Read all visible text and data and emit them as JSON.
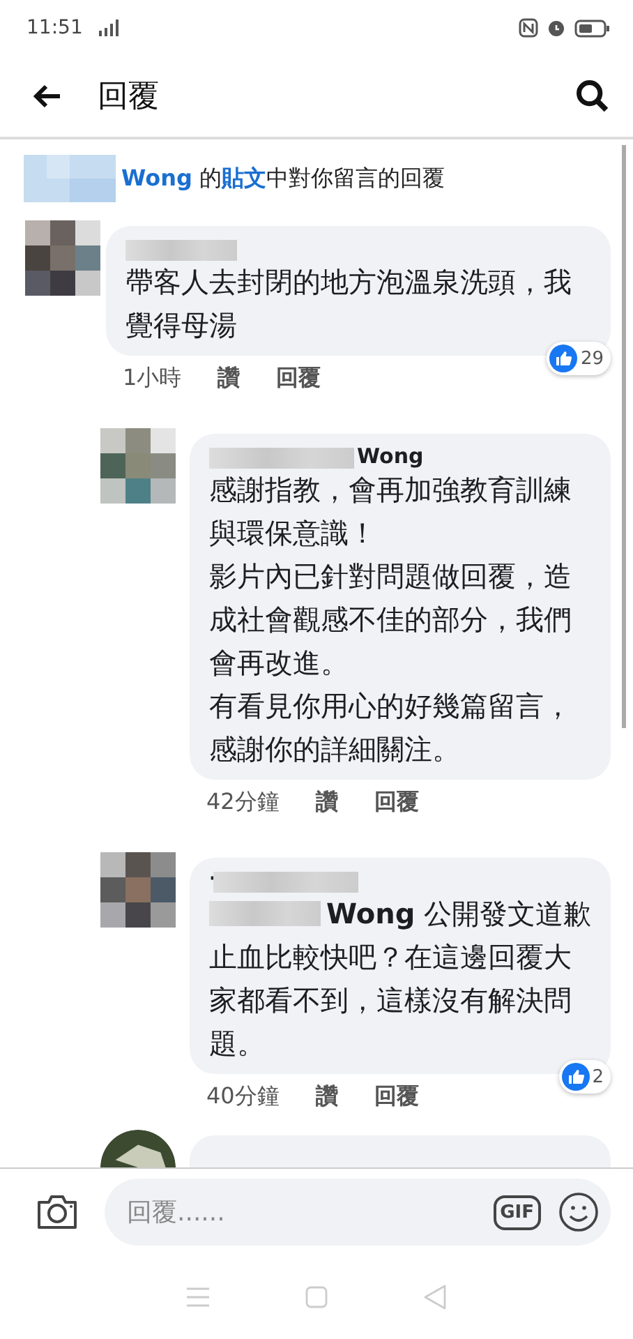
{
  "status_bar": {
    "time": "11:51"
  },
  "header": {
    "title": "回覆"
  },
  "notice": {
    "text": "**Wong** 的**貼文**中對你留言的回覆"
  },
  "comments": [
    {
      "text": "帶客人去封閉的地方泡溫泉洗頭，我覺得母湯",
      "time": "1小時",
      "like": "讚",
      "reply": "回覆",
      "reactions": "29",
      "replies": [
        {
          "author": "Wong",
          "paragraphs": [
            "感謝指教，會再加強教育訓練與環保意識！",
            "影片內已針對問題做回覆，造成社會觀感不佳的部分，我們會再改進。",
            "有看見你用心的好幾篇留言，感謝你的詳細關注。"
          ],
          "time": "42分鐘",
          "like": "讚",
          "reply": "回覆"
        },
        {
          "author": "·",
          "mention": "Wong",
          "text": " 公開發文道歉止血比較快吧？在這邊回覆大家都看不到，這樣沒有解決問題。",
          "time": "40分鐘",
          "like": "讚",
          "reply": "回覆",
          "reactions": "2"
        }
      ]
    }
  ],
  "compose": {
    "placeholder": "回覆......",
    "gif_label": "GIF"
  }
}
